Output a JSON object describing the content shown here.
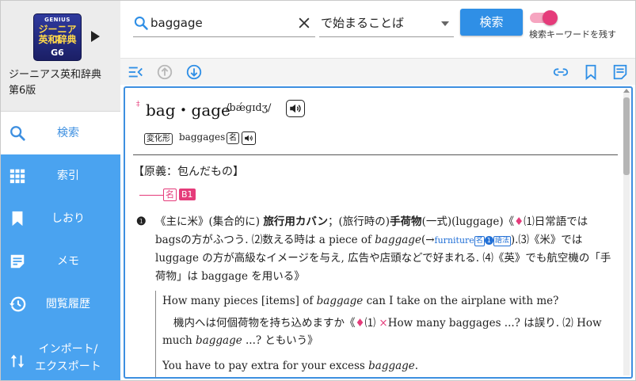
{
  "app": {
    "logo": {
      "line1": "GENIUS",
      "line2": "ジーニアス",
      "line3": "英和辞典",
      "line4": "G6"
    },
    "dictionary_name": "ジーニアス英和辞典",
    "edition": "第6版"
  },
  "sidebar": {
    "items": [
      {
        "label": "検索",
        "icon": "search-icon",
        "active": true
      },
      {
        "label": "索引",
        "icon": "grid-icon"
      },
      {
        "label": "しおり",
        "icon": "bookmark-icon"
      },
      {
        "label": "メモ",
        "icon": "memo-icon"
      },
      {
        "label": "閲覧履歴",
        "icon": "history-icon"
      },
      {
        "label_line1": "インポート/",
        "label_line2": "エクスポート",
        "icon": "import-export-icon"
      }
    ]
  },
  "search": {
    "query": "baggage",
    "mode": "で始まることば",
    "button_label": "検索",
    "keep_keyword_label": "検索キーワードを残す",
    "keep_keyword_on": true
  },
  "colors": {
    "accent": "#3d8fe0",
    "sidebar_bg": "#4aa3f0",
    "pink": "#e53b7a"
  },
  "entry": {
    "headword": "bag・gage",
    "pronunciation": "/bǽɡɪdʒ/",
    "inflection_tag": "変化形",
    "inflection_form": "baggages",
    "inflection_pos": "名",
    "etymology": "【原義：包んだもの】",
    "pos": "名",
    "cefr": "B1",
    "sense": {
      "number": "❶",
      "r0": {
        "a": "《主に米》(集合的に) ",
        "b": "旅行用カバン",
        "c": "；(旅行時の)",
        "d": "手荷物",
        "e": "(一式)(luggage)《",
        "f": "♦",
        "g": "⑴日常語では"
      },
      "r1": {
        "a": "bagsの方がふつう. ⑵数える時は a piece of ",
        "b": "baggage",
        "c": "(→",
        "d": "furniture",
        "e": "名",
        "f": "1",
        "g": "語法",
        "h": ").⑶《米》では"
      },
      "r2": {
        "a": "luggage の方が高級なイメージを与え, 広告や店頭などで好まれる. ⑷《英》でも航空機の「手"
      },
      "r3": {
        "a": "荷物」は baggage を用いる》"
      }
    },
    "examples": {
      "e1": {
        "a": "How many pieces [items] of ",
        "b": "baggage",
        "c": " can I take on the airplane with me?"
      },
      "e2": {
        "a": "機内へは何個荷物を持ち込めますか《",
        "b": "♦",
        "c": "⑴ ",
        "d": "×",
        "e": "How many baggages ...? は誤り. ⑵ How"
      },
      "e3": {
        "a": "much ",
        "b": "baggage",
        "c": " ...? ともいう》"
      },
      "e4": {
        "a": "You have to pay extra for your excess ",
        "b": "baggage",
        "c": "."
      }
    }
  }
}
